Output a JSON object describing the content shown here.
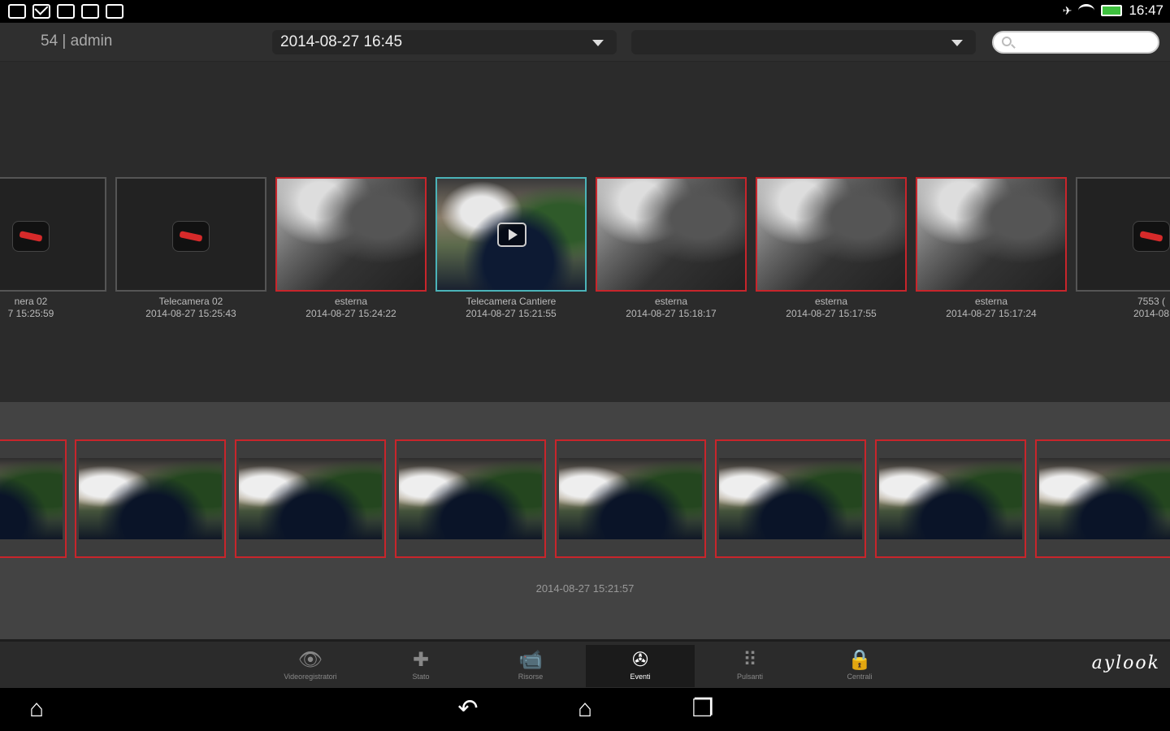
{
  "status_bar": {
    "left_icons": [
      "window-icon",
      "mail-icon",
      "edit-icon",
      "check-icon",
      "download-icon"
    ],
    "time": "16:47"
  },
  "toolbar": {
    "user_label": "54 | admin",
    "date_dropdown_value": "2014-08-27 16:45",
    "filter_dropdown_value": "",
    "search_placeholder": ""
  },
  "events": [
    {
      "name": "nera 02",
      "time": "7 15:25:59",
      "kind": "camera",
      "border": "gray",
      "icon_color": "green"
    },
    {
      "name": "Telecamera 02",
      "time": "2014-08-27 15:25:43",
      "kind": "camera",
      "border": "gray",
      "icon_color": "red"
    },
    {
      "name": "esterna",
      "time": "2014-08-27 15:24:22",
      "kind": "bw",
      "border": "red"
    },
    {
      "name": "Telecamera Cantiere",
      "time": "2014-08-27 15:21:55",
      "kind": "color",
      "border": "teal",
      "selected": true
    },
    {
      "name": "esterna",
      "time": "2014-08-27 15:18:17",
      "kind": "bw",
      "border": "red"
    },
    {
      "name": "esterna",
      "time": "2014-08-27 15:17:55",
      "kind": "bw",
      "border": "red"
    },
    {
      "name": "esterna",
      "time": "2014-08-27 15:17:24",
      "kind": "bw",
      "border": "red"
    },
    {
      "name": "7553 (",
      "time": "2014-08",
      "kind": "camera",
      "border": "gray"
    }
  ],
  "frames": {
    "count_visible": 8,
    "timestamp": "2014-08-27 15:21:57"
  },
  "tabs": [
    {
      "label": "Videoregistratori",
      "icon": "eye-icon",
      "active": false
    },
    {
      "label": "Stato",
      "icon": "medkit-icon",
      "active": false
    },
    {
      "label": "Risorse",
      "icon": "camera-icon",
      "active": false
    },
    {
      "label": "Eventi",
      "icon": "film-reel-icon",
      "active": true
    },
    {
      "label": "Pulsanti",
      "icon": "keypad-icon",
      "active": false
    },
    {
      "label": "Centrali",
      "icon": "lock-icon",
      "active": false
    }
  ],
  "brand": "aylook",
  "colors": {
    "alarm_border": "#c8252b",
    "selected_border": "#4bb3b8",
    "battery": "#3ec13e"
  }
}
